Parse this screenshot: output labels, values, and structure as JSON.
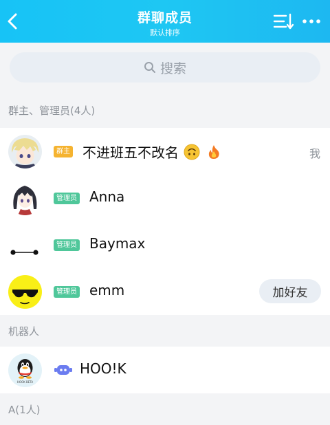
{
  "header": {
    "title": "群聊成员",
    "subtitle": "默认排序"
  },
  "search": {
    "placeholder": "搜索"
  },
  "sections": [
    {
      "title": "群主、管理员(4人)",
      "members": [
        {
          "badge": "群主",
          "name": "不进班五不改名",
          "trailing": "我"
        },
        {
          "badge": "管理员",
          "name": "Anna"
        },
        {
          "badge": "管理员",
          "name": "Baymax"
        },
        {
          "badge": "管理员",
          "name": "emm",
          "action": "加好友"
        }
      ]
    },
    {
      "title": "机器人",
      "members": [
        {
          "name": "HOO!K",
          "avatar_caption": "HOOK BETA"
        }
      ]
    },
    {
      "title": "A(1人)",
      "members": []
    }
  ],
  "colors": {
    "header_start": "#17c3f6",
    "header_end": "#1db8f1",
    "owner_badge": "#f5b330",
    "admin_badge": "#4fc79a",
    "robot_icon": "#6b7cf0"
  }
}
